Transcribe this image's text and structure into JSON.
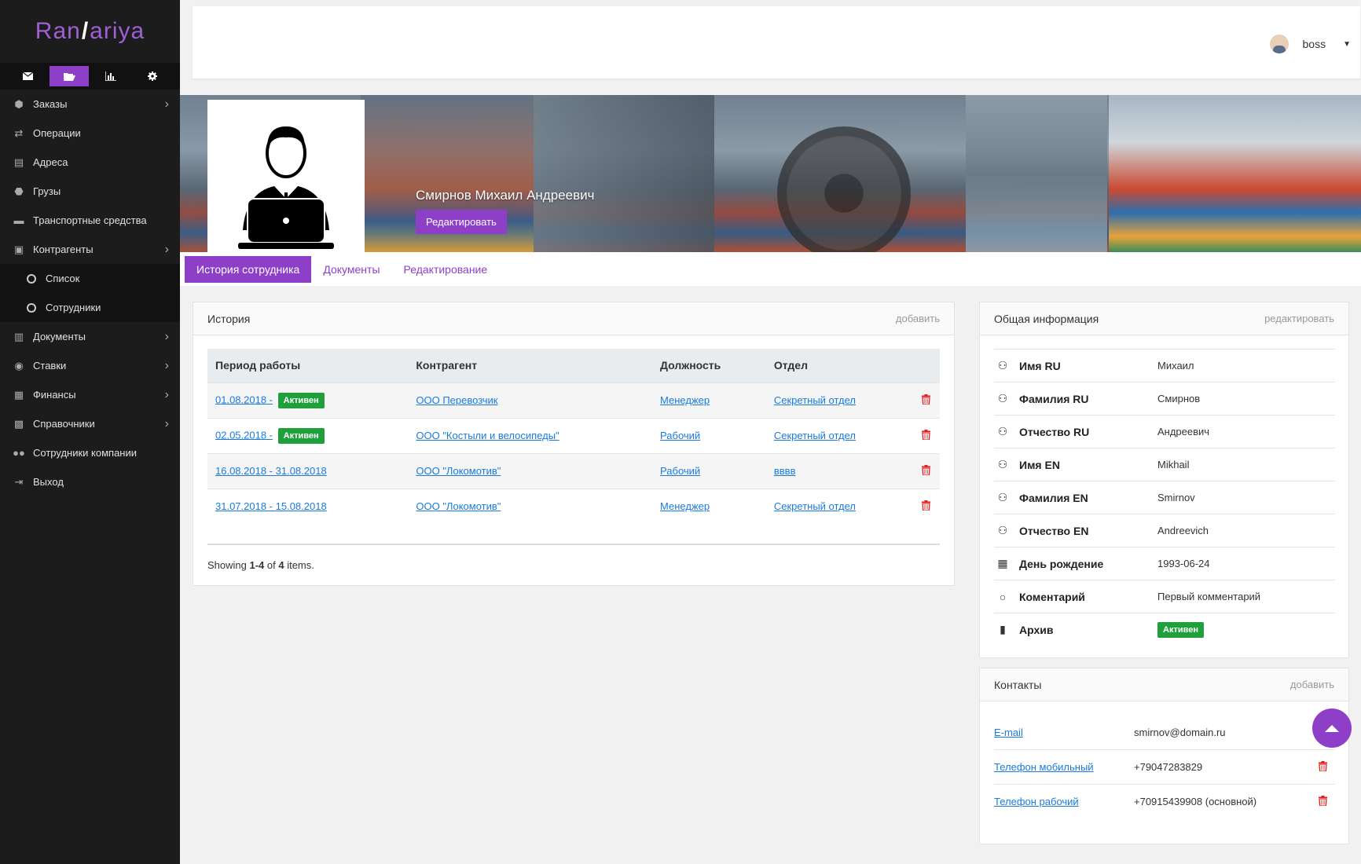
{
  "brand": {
    "left": "Ran",
    "right": "ariya"
  },
  "top_icons": [
    "envelope-icon",
    "folder-open-icon",
    "bar-chart-icon",
    "gear-icon"
  ],
  "sidebar": {
    "items": [
      {
        "label": "Заказы",
        "icon": "cube-icon",
        "has_children": true
      },
      {
        "label": "Операции",
        "icon": "exchange-icon",
        "has_children": false
      },
      {
        "label": "Адреса",
        "icon": "map-icon",
        "has_children": false
      },
      {
        "label": "Грузы",
        "icon": "cubes-icon",
        "has_children": false
      },
      {
        "label": "Транспортные средства",
        "icon": "truck-icon",
        "has_children": false
      },
      {
        "label": "Контрагенты",
        "icon": "briefcase-icon",
        "has_children": true
      },
      {
        "label": "Список",
        "icon": "circle-icon",
        "sub": true
      },
      {
        "label": "Сотрудники",
        "icon": "circle-icon",
        "sub": true
      },
      {
        "label": "Документы",
        "icon": "word-file-icon",
        "has_children": true
      },
      {
        "label": "Ставки",
        "icon": "eye-icon",
        "has_children": true
      },
      {
        "label": "Финансы",
        "icon": "newspaper-icon",
        "has_children": true
      },
      {
        "label": "Справочники",
        "icon": "archive-icon",
        "has_children": true
      },
      {
        "label": "Сотрудники компании",
        "icon": "users-icon",
        "has_children": false
      },
      {
        "label": "Выход",
        "icon": "sign-out-icon",
        "has_children": false
      }
    ]
  },
  "user": {
    "name": "boss"
  },
  "profile": {
    "full_name": "Смирнов Михаил Андреевич",
    "edit_label": "Редактировать"
  },
  "tabs": [
    {
      "label": "История сотрудника",
      "active": true
    },
    {
      "label": "Документы",
      "active": false
    },
    {
      "label": "Редактирование",
      "active": false
    }
  ],
  "history": {
    "title": "История",
    "add_label": "добавить",
    "columns": [
      "Период работы",
      "Контрагент",
      "Должность",
      "Отдел"
    ],
    "rows": [
      {
        "period": "01.08.2018 -",
        "badge": "Активен",
        "contractor": "ООО Перевозчик",
        "position": "Менеджер",
        "department": "Секретный отдел"
      },
      {
        "period": "02.05.2018 -",
        "badge": "Активен",
        "contractor": "ООО \"Костыли и велосипеды\"",
        "position": "Рабочий",
        "department": "Секретный отдел"
      },
      {
        "period": "16.08.2018 - 31.08.2018",
        "badge": "",
        "contractor": "ООО \"Локомотив\"",
        "position": "Рабочий",
        "department": "вввв"
      },
      {
        "period": "31.07.2018 - 15.08.2018",
        "badge": "",
        "contractor": "ООО \"Локомотив\"",
        "position": "Менеджер",
        "department": "Секретный отдел"
      }
    ],
    "footer": {
      "prefix": "Showing ",
      "range": "1-4",
      "of": " of ",
      "total": "4",
      "suffix": " items."
    }
  },
  "info": {
    "title": "Общая информация",
    "edit_label": "редактировать",
    "rows": [
      {
        "label": "Имя RU",
        "value": "Михаил",
        "icon": "user-icon"
      },
      {
        "label": "Фамилия RU",
        "value": "Смирнов",
        "icon": "user-icon"
      },
      {
        "label": "Отчество RU",
        "value": "Андреевич",
        "icon": "user-icon"
      },
      {
        "label": "Имя EN",
        "value": "Mikhail",
        "icon": "user-icon"
      },
      {
        "label": "Фамилия EN",
        "value": "Smirnov",
        "icon": "user-icon"
      },
      {
        "label": "Отчество EN",
        "value": "Andreevich",
        "icon": "user-icon"
      },
      {
        "label": "День рождение",
        "value": "1993-06-24",
        "icon": "calendar-icon"
      },
      {
        "label": "Коментарий",
        "value": "Первый комментарий",
        "icon": "comment-icon"
      },
      {
        "label": "Архив",
        "value": "Активен",
        "icon": "book-icon",
        "badge": true
      }
    ]
  },
  "contacts": {
    "title": "Контакты",
    "add_label": "добавить",
    "rows": [
      {
        "type": "E-mail",
        "value": "smirnov@domain.ru",
        "deletable": false
      },
      {
        "type": "Телефон мобильный",
        "value": "+79047283829",
        "deletable": true
      },
      {
        "type": "Телефон рабочий",
        "value": "+70915439908 (основной)",
        "deletable": true
      }
    ]
  },
  "colors": {
    "accent": "#8e3fc8",
    "success": "#1fa03a",
    "danger": "#e02020",
    "link": "#1a7be0",
    "sidebar": "#1c1c1c"
  }
}
